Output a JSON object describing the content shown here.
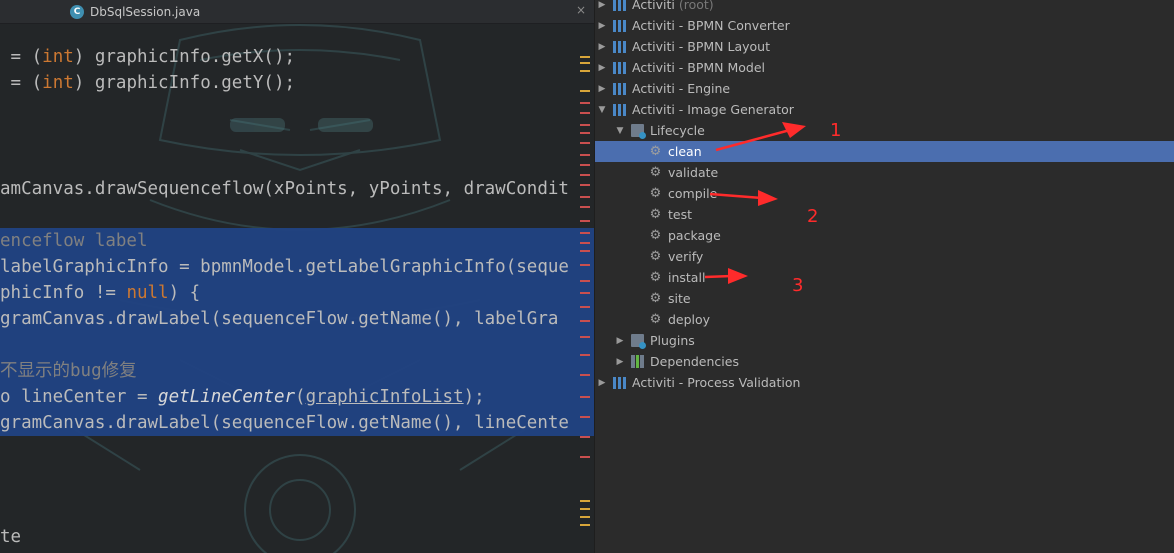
{
  "editor": {
    "tab_label": "DbSqlSession.java",
    "tab_icon_letter": "C",
    "tab_close": "×",
    "code_lines": [
      {
        "parts": [
          {
            "t": " = (",
            "c": ""
          },
          {
            "t": "int",
            "c": "kw"
          },
          {
            "t": ") graphicInfo.getX();",
            "c": ""
          }
        ]
      },
      {
        "parts": [
          {
            "t": " = (",
            "c": ""
          },
          {
            "t": "int",
            "c": "kw"
          },
          {
            "t": ") graphicInfo.getY();",
            "c": ""
          }
        ]
      },
      {
        "parts": [
          {
            "t": "amCanvas.drawSequenceflow(xPoints, yPoints, drawCondit",
            "c": ""
          }
        ]
      },
      {
        "parts": [
          {
            "t": "enceflow label",
            "c": "cm"
          }
        ]
      },
      {
        "parts": [
          {
            "t": "labelGraphicInfo = bpmnModel.getLabelGraphicInfo(seque",
            "c": ""
          }
        ]
      },
      {
        "parts": [
          {
            "t": "phicInfo != ",
            "c": ""
          },
          {
            "t": "null",
            "c": "kw"
          },
          {
            "t": ") {",
            "c": ""
          }
        ]
      },
      {
        "parts": [
          {
            "t": "gramCanvas.drawLabel(sequenceFlow.getName(), labelGra",
            "c": ""
          }
        ]
      },
      {
        "parts": [
          {
            "t": "不显示的bug修复",
            "c": "cm"
          }
        ]
      },
      {
        "parts": [
          {
            "t": "o lineCenter = ",
            "c": ""
          },
          {
            "t": "getLineCenter",
            "c": "it"
          },
          {
            "t": "(",
            "c": ""
          },
          {
            "t": "graphicInfoList",
            "c": "ul"
          },
          {
            "t": ");",
            "c": ""
          }
        ]
      },
      {
        "parts": [
          {
            "t": "gramCanvas.drawLabel(sequenceFlow.getName(), lineCente",
            "c": ""
          }
        ]
      },
      {
        "parts": [
          {
            "t": "te",
            "c": ""
          }
        ]
      }
    ]
  },
  "tree": {
    "items": [
      {
        "label": "Activiti",
        "suffix": "(root)",
        "arrow": "▶",
        "icon": "maven-icon",
        "level": 0
      },
      {
        "label": "Activiti - BPMN Converter",
        "arrow": "▶",
        "icon": "maven-icon",
        "level": 0
      },
      {
        "label": "Activiti - BPMN Layout",
        "arrow": "▶",
        "icon": "maven-icon",
        "level": 0
      },
      {
        "label": "Activiti - BPMN Model",
        "arrow": "▶",
        "icon": "maven-icon",
        "level": 0
      },
      {
        "label": "Activiti - Engine",
        "arrow": "▶",
        "icon": "maven-icon",
        "level": 0
      },
      {
        "label": "Activiti - Image Generator",
        "arrow": "▼",
        "icon": "maven-icon",
        "level": 0
      },
      {
        "label": "Lifecycle",
        "arrow": "▼",
        "icon": "folder-icon",
        "level": 1
      },
      {
        "label": "clean",
        "arrow": "",
        "icon": "gear-icon",
        "level": 2,
        "active": true
      },
      {
        "label": "validate",
        "arrow": "",
        "icon": "gear-icon",
        "level": 2
      },
      {
        "label": "compile",
        "arrow": "",
        "icon": "gear-icon",
        "level": 2
      },
      {
        "label": "test",
        "arrow": "",
        "icon": "gear-icon",
        "level": 2
      },
      {
        "label": "package",
        "arrow": "",
        "icon": "gear-icon",
        "level": 2
      },
      {
        "label": "verify",
        "arrow": "",
        "icon": "gear-icon",
        "level": 2
      },
      {
        "label": "install",
        "arrow": "",
        "icon": "gear-icon",
        "level": 2
      },
      {
        "label": "site",
        "arrow": "",
        "icon": "gear-icon",
        "level": 2
      },
      {
        "label": "deploy",
        "arrow": "",
        "icon": "gear-icon",
        "level": 2
      },
      {
        "label": "Plugins",
        "arrow": "▶",
        "icon": "folder-icon",
        "level": 1
      },
      {
        "label": "Dependencies",
        "arrow": "▶",
        "icon": "deps-icon",
        "level": 1
      },
      {
        "label": "Activiti - Process Validation",
        "arrow": "▶",
        "icon": "maven-icon",
        "level": 0
      }
    ]
  },
  "annotations": {
    "labels": [
      "1",
      "2",
      "3"
    ],
    "color": "#ff2b2b"
  },
  "colors": {
    "selection": "#214283",
    "tree_active": "#4b6eaf",
    "keyword": "#cc7832"
  }
}
